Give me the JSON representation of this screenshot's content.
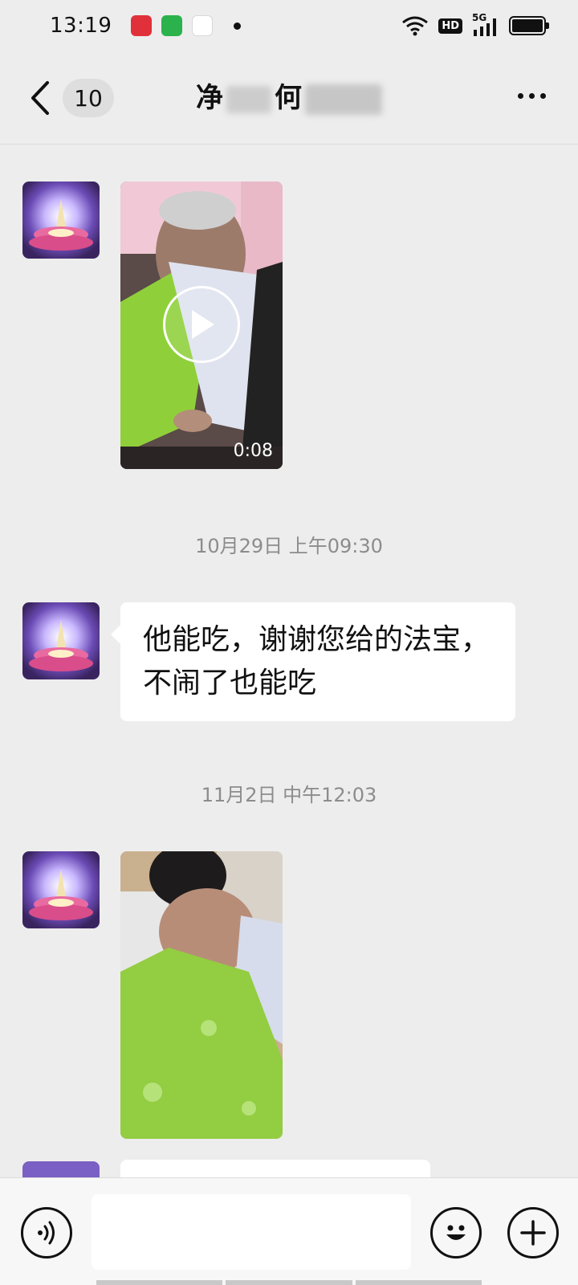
{
  "status_bar": {
    "time": "13:19",
    "network": "5G",
    "hd_label": "HD",
    "apps": [
      "red-app-icon",
      "green-app-icon",
      "baidu-app-icon"
    ]
  },
  "header": {
    "unread_count": "10",
    "title_char_1": "净",
    "title_char_2": "何",
    "more_icon": "more-dots-icon",
    "back_icon": "back-chevron-icon"
  },
  "messages": [
    {
      "type": "video",
      "duration": "0:08"
    },
    {
      "type": "timestamp",
      "text": "10月29日 上午09:30"
    },
    {
      "type": "text",
      "text": "他能吃，谢谢您给的法宝，不闹了也能吃"
    },
    {
      "type": "timestamp",
      "text": "11月2日 中午12:03"
    },
    {
      "type": "image"
    }
  ],
  "input_bar": {
    "voice_icon": "voice-icon",
    "emoji_icon": "emoji-icon",
    "plus_icon": "plus-icon",
    "input_value": ""
  },
  "colors": {
    "background": "#ededed",
    "bubble": "#ffffff",
    "timestamp_text": "#8c8c8c"
  }
}
